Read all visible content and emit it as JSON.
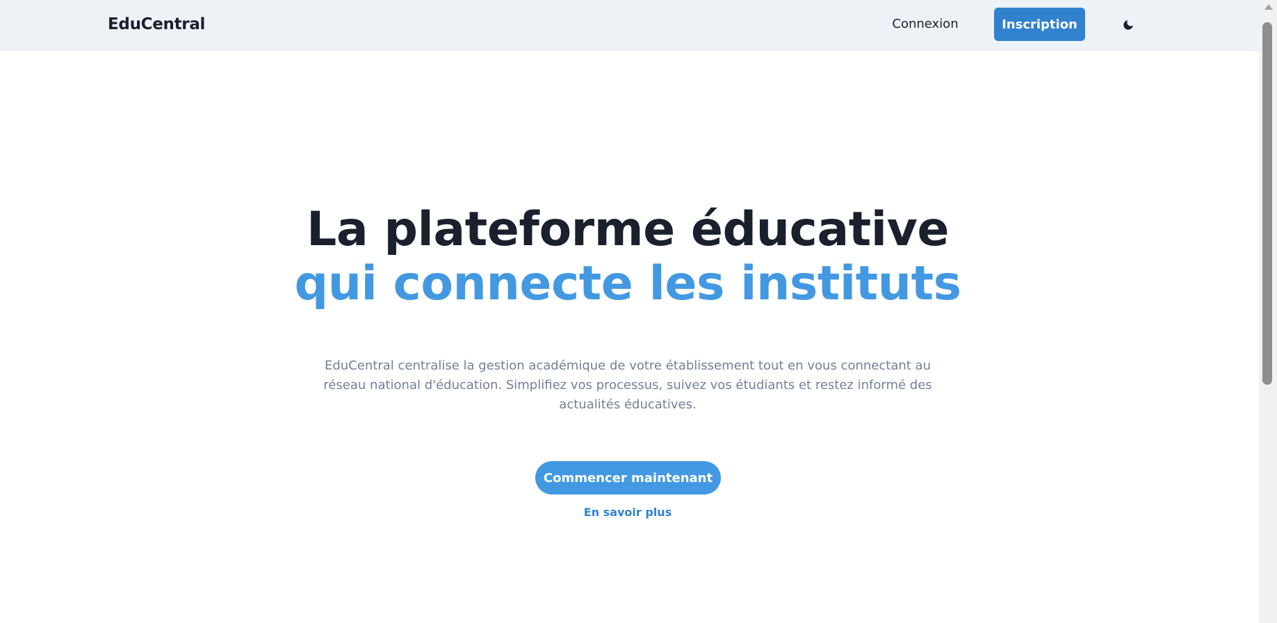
{
  "header": {
    "brand": "EduCentral",
    "login_label": "Connexion",
    "signup_label": "Inscription",
    "theme_toggle_icon": "moon-icon"
  },
  "hero": {
    "title_line1": "La plateforme éducative",
    "title_line2": "qui connecte les instituts",
    "description": "EduCentral centralise la gestion académique de votre établissement tout en vous connectant au réseau national d'éducation. Simplifiez vos processus, suivez vos étudiants et restez informé des actualités éducatives.",
    "cta_primary": "Commencer maintenant",
    "cta_secondary": "En savoir plus"
  },
  "colors": {
    "primary": "#3182ce",
    "accent": "#4299e1",
    "text_dark": "#1a202c",
    "text_muted": "#718096",
    "header_bg": "#edf2f7"
  }
}
